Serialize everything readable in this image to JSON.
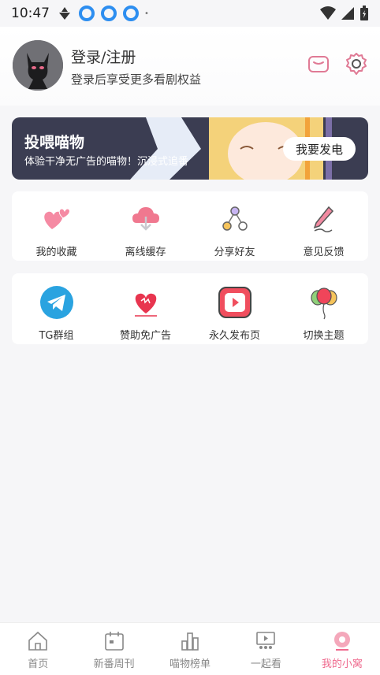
{
  "status_bar": {
    "time": "10:47"
  },
  "header": {
    "login_title": "登录/注册",
    "login_subtitle": "登录后享受更多看剧权益"
  },
  "banner": {
    "title": "投喂喵物",
    "subtitle": "体验干净无广告的喵物！沉浸式追番",
    "button_label": "我要发电"
  },
  "quick_actions": [
    {
      "label": "我的收藏"
    },
    {
      "label": "离线缓存"
    },
    {
      "label": "分享好友"
    },
    {
      "label": "意见反馈"
    }
  ],
  "extra_actions": [
    {
      "label": "TG群组"
    },
    {
      "label": "赞助免广告"
    },
    {
      "label": "永久发布页"
    },
    {
      "label": "切换主题"
    }
  ],
  "bottom_nav": [
    {
      "label": "首页"
    },
    {
      "label": "新番周刊"
    },
    {
      "label": "喵物榜单"
    },
    {
      "label": "一起看"
    },
    {
      "label": "我的小窝"
    }
  ],
  "colors": {
    "accent": "#ef6a8e",
    "banner_bg": "#3b3d52",
    "tg_blue": "#2aa3e0"
  }
}
